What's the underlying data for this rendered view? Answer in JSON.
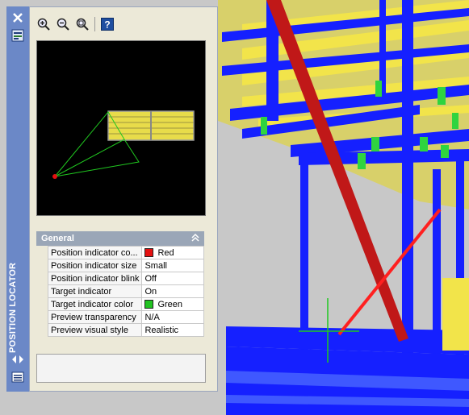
{
  "palette": {
    "title": "POSITION LOCATOR",
    "section": "General",
    "properties": [
      {
        "name": "Position indicator co...",
        "value": "Red",
        "swatch": "#e41010"
      },
      {
        "name": "Position indicator size",
        "value": "Small"
      },
      {
        "name": "Position indicator blink",
        "value": "Off"
      },
      {
        "name": "Target indicator",
        "value": "On"
      },
      {
        "name": "Target indicator color",
        "value": "Green",
        "swatch": "#22c322"
      },
      {
        "name": "Preview transparency",
        "value": "N/A"
      },
      {
        "name": "Preview visual style",
        "value": "Realistic"
      }
    ],
    "toolbar_icons": [
      "zoom-in-icon",
      "zoom-out-icon",
      "zoom-extents-icon",
      "help-icon"
    ],
    "titlebar_icons": [
      "close-icon",
      "properties-icon",
      "auto-hide-icon",
      "menu-icon"
    ]
  }
}
